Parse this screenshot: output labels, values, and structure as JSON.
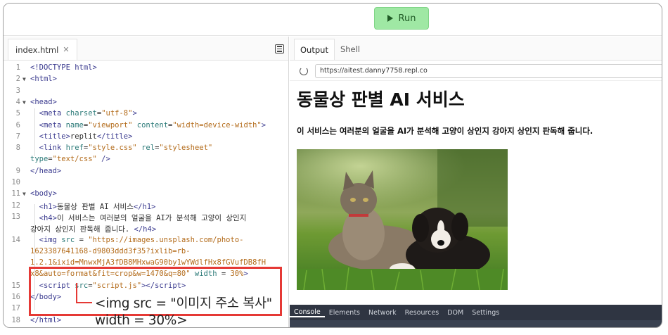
{
  "toolbar": {
    "run_label": "Run"
  },
  "editor": {
    "file_tab": "index.html",
    "lines": [
      {
        "n": "1",
        "fold": "",
        "html": "<span class=\"tag\">&lt;!DOCTYPE html&gt;</span>"
      },
      {
        "n": "2",
        "fold": "▼",
        "html": "<span class=\"tag\">&lt;html&gt;</span>"
      },
      {
        "n": "3",
        "fold": "",
        "html": ""
      },
      {
        "n": "4",
        "fold": "▼",
        "html": "<span class=\"tag\">&lt;head&gt;</span>"
      },
      {
        "n": "5",
        "fold": "",
        "html": "  <span class=\"tag\">&lt;meta</span> <span class=\"attr\">charset</span>=<span class=\"str\">\"utf-8\"</span><span class=\"tag\">&gt;</span>"
      },
      {
        "n": "6",
        "fold": "",
        "html": "  <span class=\"tag\">&lt;meta</span> <span class=\"attr\">name</span>=<span class=\"str\">\"viewport\"</span> <span class=\"attr\">content</span>=<span class=\"str\">\"width=device-width\"</span><span class=\"tag\">&gt;</span>"
      },
      {
        "n": "7",
        "fold": "",
        "html": "  <span class=\"tag\">&lt;title&gt;</span>replit<span class=\"tag\">&lt;/title&gt;</span>"
      },
      {
        "n": "8",
        "fold": "",
        "html": "  <span class=\"tag\">&lt;link</span> <span class=\"attr\">href</span>=<span class=\"str\">\"style.css\"</span> <span class=\"attr\">rel</span>=<span class=\"str\">\"stylesheet\"</span>"
      },
      {
        "n": "",
        "fold": "",
        "html": "<span class=\"attr\">type</span>=<span class=\"str\">\"text/css\"</span> <span class=\"tag\">/&gt;</span>"
      },
      {
        "n": "9",
        "fold": "",
        "html": "<span class=\"tag\">&lt;/head&gt;</span>"
      },
      {
        "n": "10",
        "fold": "",
        "html": ""
      },
      {
        "n": "11",
        "fold": "▼",
        "html": "<span class=\"tag\">&lt;body&gt;</span>"
      },
      {
        "n": "12",
        "fold": "",
        "html": "  <span class=\"tag\">&lt;h1&gt;</span>동물상 판별 AI 서비스<span class=\"tag\">&lt;/h1&gt;</span>"
      },
      {
        "n": "13",
        "fold": "",
        "html": "  <span class=\"tag\">&lt;h4&gt;</span>이 서비스는 여러분의 얼굴을 AI가 분석해 고양이 상인지"
      },
      {
        "n": "",
        "fold": "",
        "html": "강아지 상인지 판독해 줍니다. <span class=\"tag\">&lt;/h4&gt;</span>"
      },
      {
        "n": "14",
        "fold": "",
        "html": "  <span class=\"tag\">&lt;img</span> <span class=\"attr\">src</span> = <span class=\"str\">\"https://images.unsplash.com/photo-</span>"
      },
      {
        "n": "",
        "fold": "",
        "html": "<span class=\"str\">1623387641168-d9803ddd3f35?ixlib=rb-</span>"
      },
      {
        "n": "",
        "fold": "",
        "html": "<span class=\"str\">1.2.1&amp;ixid=MnwxMjA3fDB8MHxwaG90by1wYWdlfHx8fGVufDB8fH</span>"
      },
      {
        "n": "",
        "fold": "",
        "html": "<span class=\"str\">x8&amp;auto=format&amp;fit=crop&amp;w=1470&amp;q=80\"</span> <span class=\"attr\">width</span> = <span class=\"str\">30%</span><span class=\"tag\">&gt;</span>"
      },
      {
        "n": "15",
        "fold": "",
        "html": "  <span class=\"tag\">&lt;script</span> <span class=\"attr\">src</span>=<span class=\"str\">\"script.js\"</span><span class=\"tag\">&gt;&lt;/script&gt;</span>"
      },
      {
        "n": "16",
        "fold": "",
        "html": "<span class=\"tag\">&lt;/body&gt;</span>"
      },
      {
        "n": "17",
        "fold": "",
        "html": ""
      },
      {
        "n": "18",
        "fold": "",
        "html": "<span class=\"tag\">&lt;/html&gt;</span>"
      }
    ]
  },
  "callout": {
    "line1": "<img src = \"이미지 주소 복사\"",
    "line2": "width = 30%>"
  },
  "output": {
    "tabs": [
      "Output",
      "Shell"
    ],
    "url": "https://aitest.danny7758.repl.co",
    "heading": "동물상 판별 AI 서비스",
    "subheading": "이 서비스는 여러분의 얼굴을 AI가 분석해 고양이 상인지 강아지 상인지 판독해 줍니다.",
    "image_alt": "cat-and-dog-photo"
  },
  "devtools": {
    "tabs": [
      "Console",
      "Elements",
      "Network",
      "Resources",
      "DOM",
      "Settings"
    ]
  },
  "colors": {
    "run_bg": "#9fe8a4",
    "highlight": "#e53935",
    "devtools_bg": "#2f3542"
  }
}
